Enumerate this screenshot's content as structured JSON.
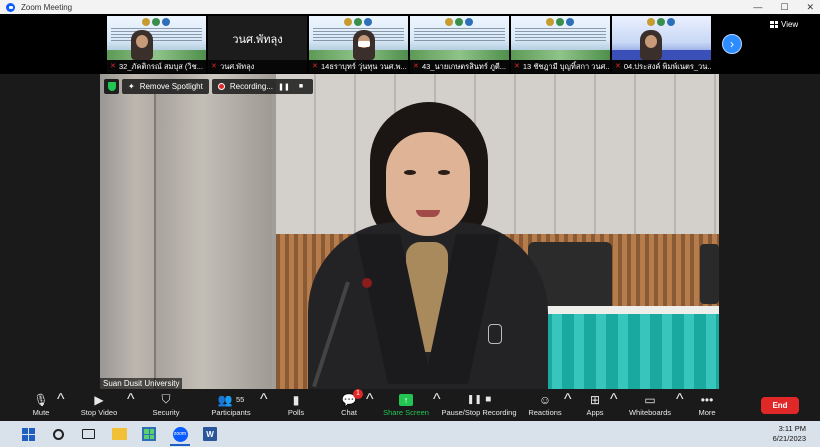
{
  "window": {
    "title": "Zoom Meeting"
  },
  "title_controls": {
    "minimize": "—",
    "maximize": "☐",
    "close": "✕"
  },
  "gallery": {
    "view_label": "View",
    "next_icon": "chevron-right-icon",
    "thumbnails": [
      {
        "name": "32_ภัคติกรณ์ สมบุส (วิช...",
        "type": "slide-person"
      },
      {
        "name": "วนศ.พัทลุง",
        "type": "text",
        "center_text": "วนศ.พัทลุง"
      },
      {
        "name": "14ธราบุทร์ วุ่นทุน วนศ.พ...",
        "type": "slide-person-mask"
      },
      {
        "name": "43_นายเกษตรสินทร์ ภูตี...",
        "type": "slide"
      },
      {
        "name": "13 ชัชฎามี บุญทิ์สกา วนศ...",
        "type": "slide"
      },
      {
        "name": "04.ประสงค์ พิมพ์เนตร_วน...",
        "type": "slide-person-blue"
      }
    ]
  },
  "spotlight": {
    "remove_label": "Remove Spotlight",
    "recording_label": "Recording...",
    "pause_icon": "pause-icon",
    "stop_icon": "stop-icon"
  },
  "main_video": {
    "label": "Suan Dusit University"
  },
  "toolbar": {
    "mute": "Mute",
    "stop_video": "Stop Video",
    "security": "Security",
    "participants": "Participants",
    "participants_count": "55",
    "polls": "Polls",
    "chat": "Chat",
    "chat_badge": "1",
    "share_screen": "Share Screen",
    "pause_stop_recording": "Pause/Stop Recording",
    "reactions": "Reactions",
    "apps": "Apps",
    "whiteboards": "Whiteboards",
    "more": "More",
    "end": "End"
  },
  "taskbar": {
    "time": "3:11 PM",
    "date": "6/21/2023",
    "word_letter": "W",
    "zoom_text": "zoom"
  },
  "colors": {
    "accent": "#2d8cff",
    "end": "#e02828",
    "share": "#23c552",
    "toolbar_bg": "#1a1a1a"
  }
}
